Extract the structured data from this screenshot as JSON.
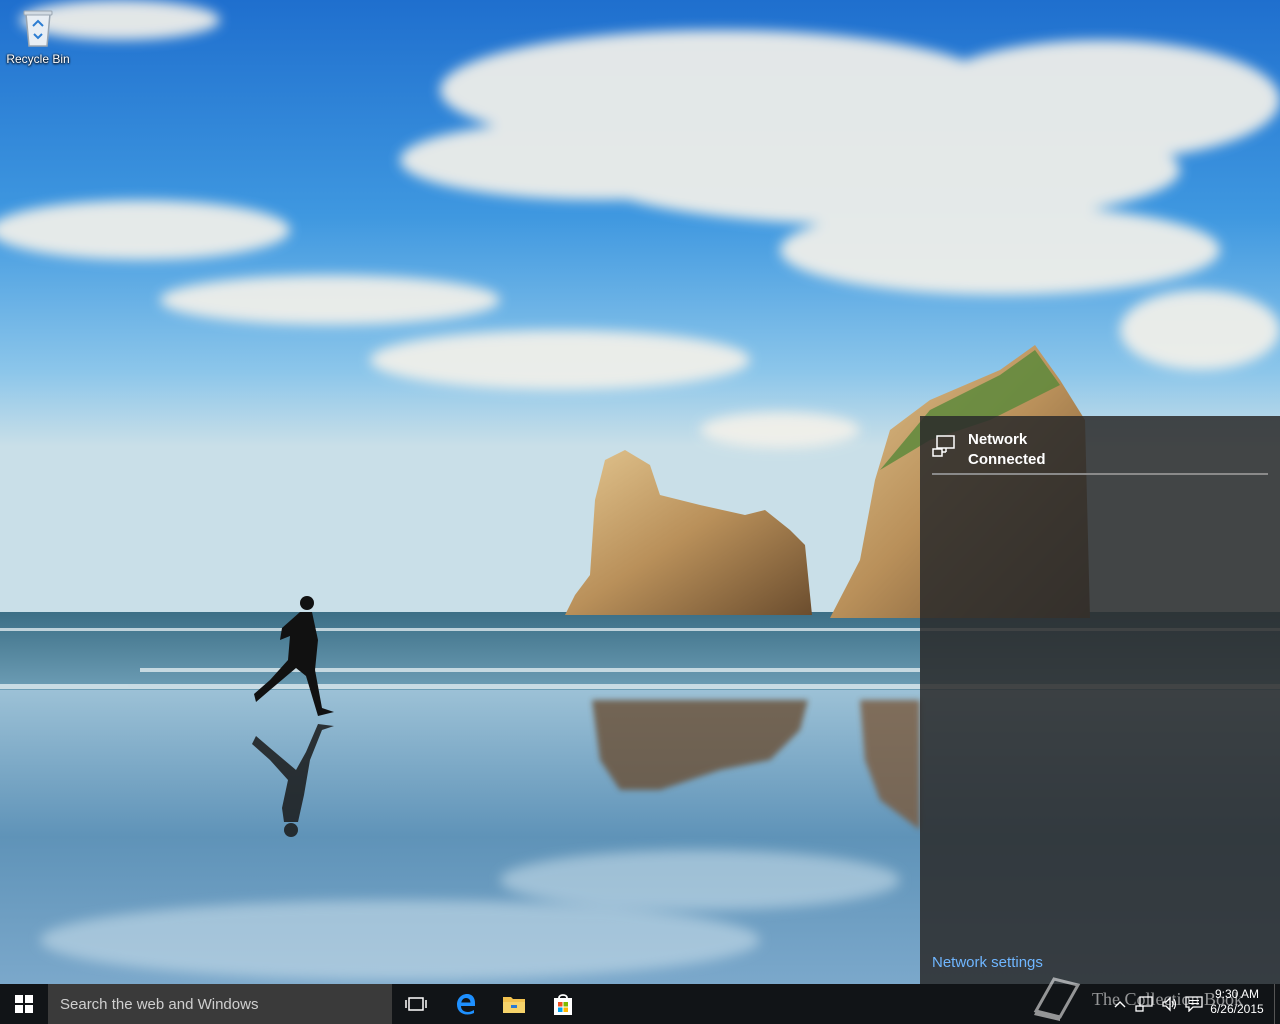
{
  "desktop": {
    "icons": [
      {
        "label": "Recycle Bin",
        "icon": "recycle-bin-icon"
      }
    ]
  },
  "network_flyout": {
    "network_name": "Network",
    "network_status": "Connected",
    "settings_link": "Network settings"
  },
  "taskbar": {
    "search_placeholder": "Search the web and Windows",
    "pinned": [
      {
        "name": "task-view",
        "icon": "task-view-icon"
      },
      {
        "name": "edge",
        "icon": "edge-icon"
      },
      {
        "name": "file-explorer",
        "icon": "folder-icon"
      },
      {
        "name": "store",
        "icon": "store-icon"
      }
    ],
    "clock_time": "9:30 AM",
    "clock_date": "6/26/2015"
  },
  "watermark": {
    "text": "The Collection Book"
  },
  "colors": {
    "accent": "#1e90ff",
    "link": "#6fb6ff",
    "taskbar": "#111417",
    "flyout": "#2b2b2b"
  }
}
